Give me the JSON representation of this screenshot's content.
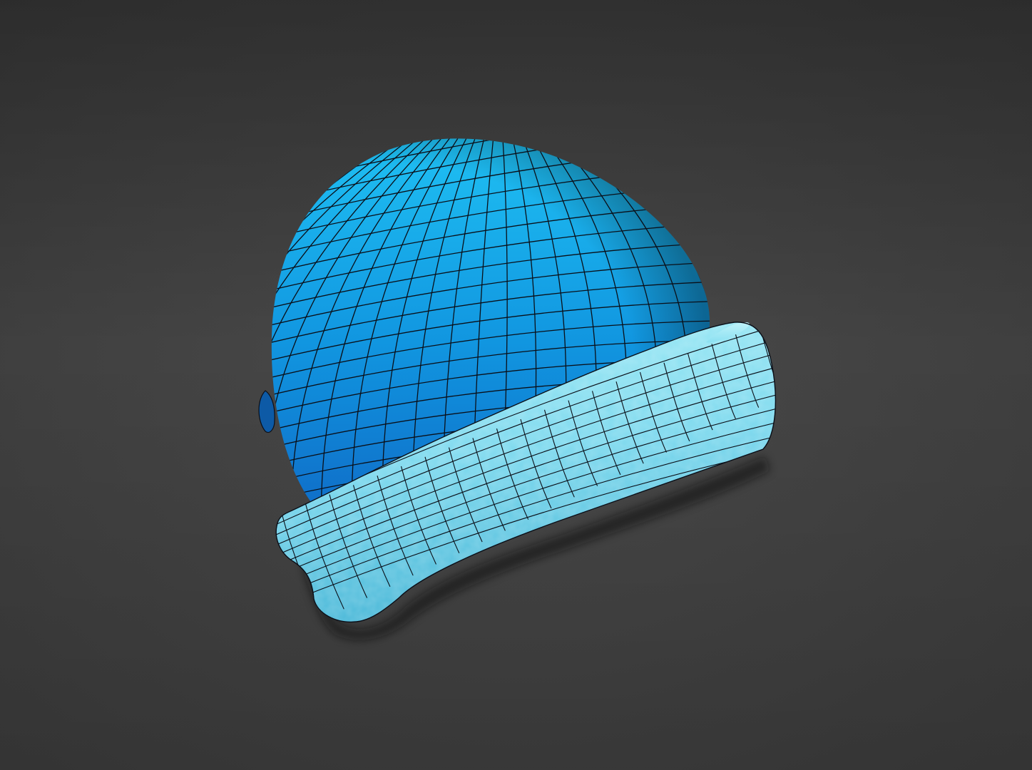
{
  "viewport": {
    "background_top": "#2c2c2c",
    "background_mid": "#4a4a4a",
    "background_bottom": "#3a3a3a"
  },
  "model": {
    "object": "beanie-hat",
    "display_mode": "shaded-with-wireframe",
    "colors": {
      "crown_light": "#1fc0f3",
      "crown_mid": "#1196e0",
      "crown_dark": "#0f6fc9",
      "cuff_light": "#a3ecf6",
      "cuff_mid": "#7dd9ee",
      "cuff_dark": "#4ab8d8",
      "wire": "#0b0f18"
    }
  }
}
